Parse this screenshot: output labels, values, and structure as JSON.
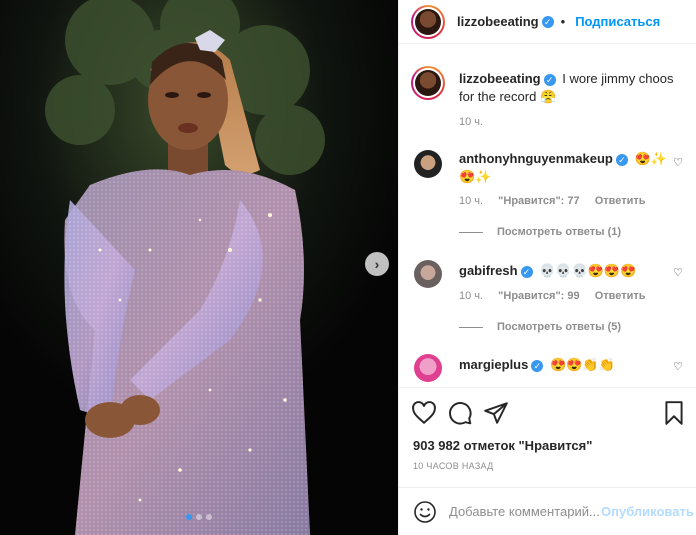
{
  "post": {
    "author": "lizzobeeating",
    "follow_label": "Подписаться",
    "separator": "•"
  },
  "caption": {
    "username": "lizzobeeating",
    "text": "I wore jimmy choos for the record",
    "emoji": "😤",
    "time": "10 ч."
  },
  "comments": [
    {
      "username": "anthonyhnguyenmakeup",
      "emoji": "😍✨",
      "emoji2": "😍✨",
      "time": "10 ч.",
      "likes": "\"Нравится\": 77",
      "reply": "Ответить",
      "view_replies": "Посмотреть ответы (1)"
    },
    {
      "username": "gabifresh",
      "emoji": "💀💀💀😍😍😍",
      "time": "10 ч.",
      "likes": "\"Нравится\": 99",
      "reply": "Ответить",
      "view_replies": "Посмотреть ответы (5)"
    },
    {
      "username": "margieplus",
      "emoji": "😍😍👏👏"
    }
  ],
  "likes_count": "903 982 отметок \"Нравится\"",
  "timestamp": "10 ЧАСОВ НАЗАД",
  "add_comment": {
    "placeholder": "Добавьте комментарий...",
    "post_label": "Опубликовать"
  },
  "colors": {
    "accent": "#0095f6",
    "verified": "#3897f0"
  },
  "icons": [
    "heart-icon",
    "comment-icon",
    "share-icon",
    "bookmark-icon",
    "smile-icon",
    "chevron-right-icon",
    "verified-icon"
  ]
}
